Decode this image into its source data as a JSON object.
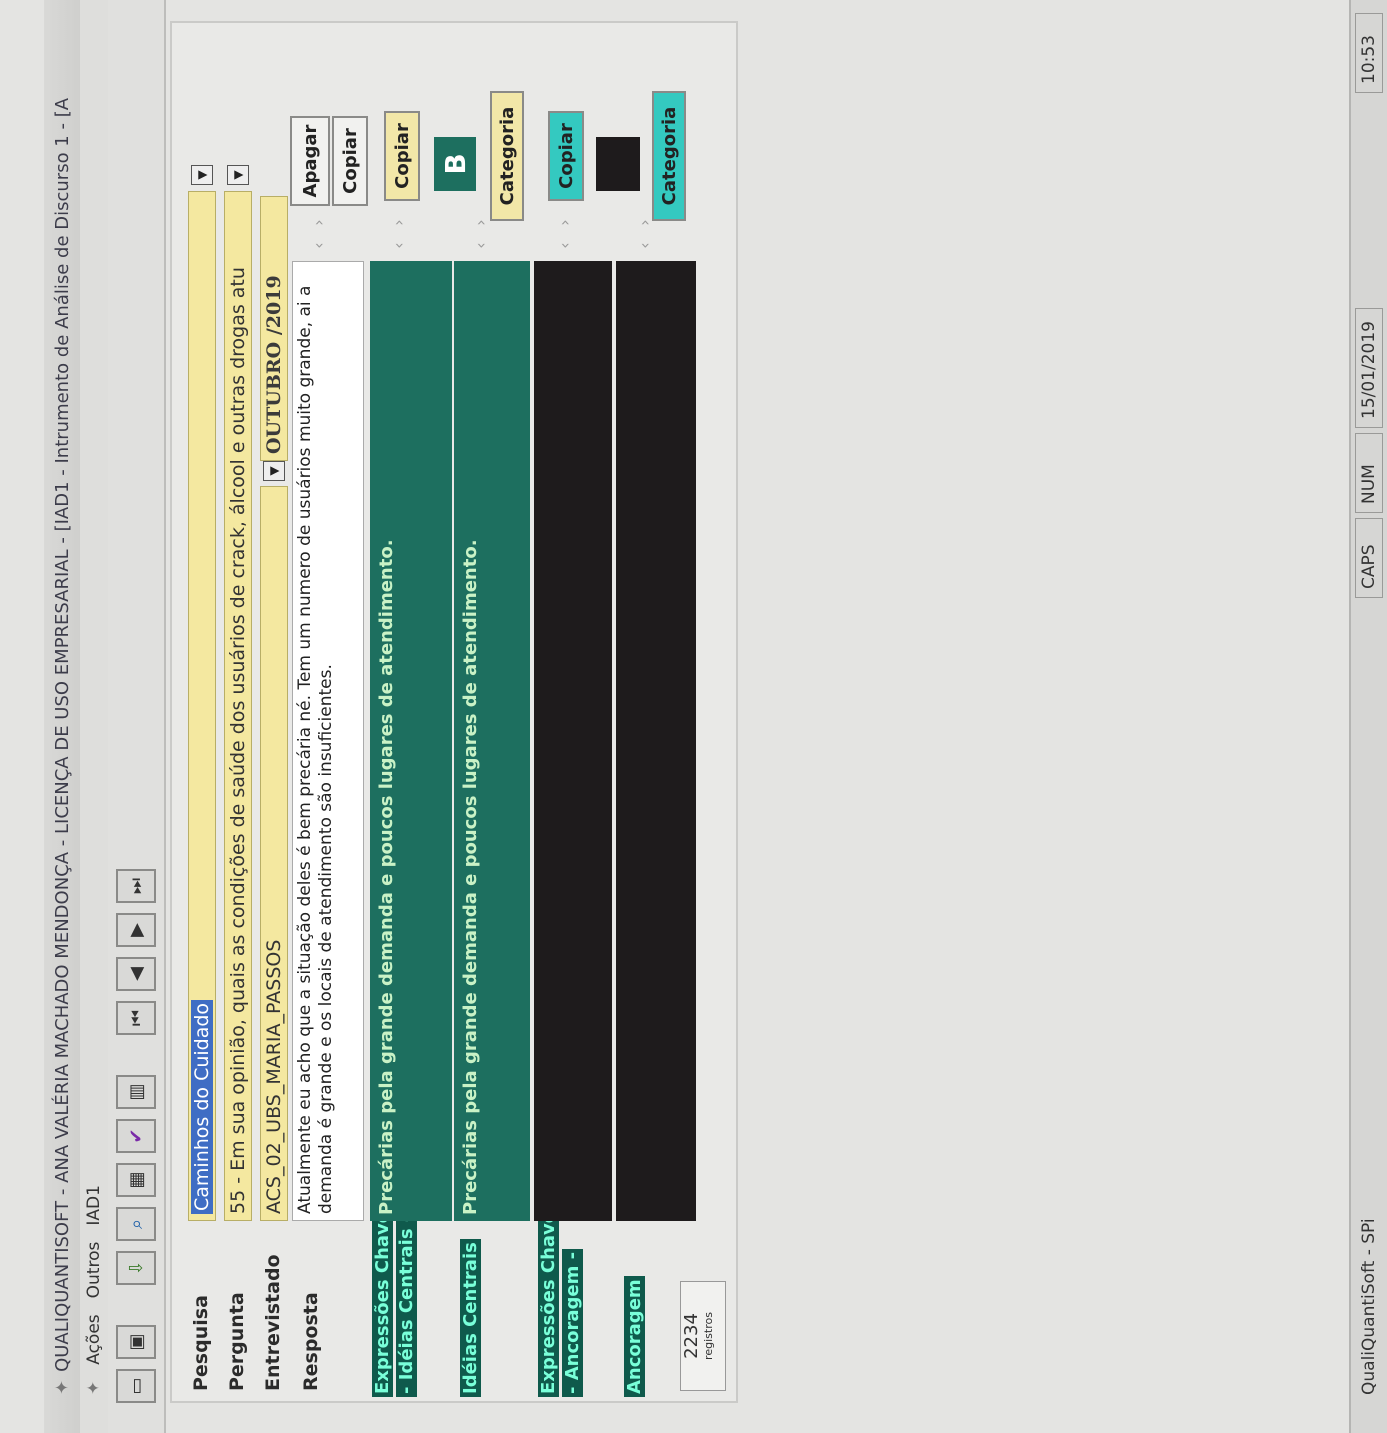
{
  "window": {
    "title": "QUALIQUANTISOFT - ANA VALÉRIA MACHADO MENDONÇA - LICENÇA DE USO EMPRESARIAL - [IAD1 - Intrumento de Análise de Discurso 1 - [A"
  },
  "menu": [
    "Ações",
    "Outros",
    "IAD1"
  ],
  "toolbar": {
    "icons": [
      "new-icon",
      "save-icon",
      "import-icon",
      "search-icon",
      "grid-icon",
      "spellcheck-icon",
      "delete-icon",
      "first-record-icon",
      "prev-record-icon",
      "next-record-icon",
      "last-record-icon"
    ]
  },
  "form": {
    "pesquisa_label": "Pesquisa",
    "pesquisa_value": "Caminhos do Cuidado",
    "pergunta_label": "Pergunta",
    "pergunta_value": "55 - Em sua opinião, quais as condições de saúde dos usuários de crack, álcool e outras drogas atu",
    "entrevistado_label": "Entrevistado",
    "entrevistado_value": "ACS_02_UBS_MARIA_PASSOS",
    "mes": "OUTUBRO /2019",
    "resposta_label": "Resposta",
    "resposta_text": "Atualmente eu acho que a situação deles é bem precária né. Tem um numero de usuários muito grande, ai a demanda é grande e os locais de atendimento são insuficientes.",
    "ec_label_1": "Expressões Chave",
    "ec_label_2": "- Idéias Centrais -",
    "ec_text": "Precárias pela grande demanda e poucos lugares de atendimento.",
    "ic_label": "Idéias Centrais",
    "ic_text": "Precárias pela grande demanda e poucos lugares de atendimento.",
    "eca_label_1": "Expressões Chave",
    "eca_label_2": "- Ancoragem -",
    "anc_label": "Ancoragem",
    "records_count": "2234",
    "records_label": "registros"
  },
  "buttons": {
    "apagar": "Apagar",
    "copiar": "Copiar",
    "copiar_ic": "Copiar",
    "category_letter": "B",
    "categoria": "Categoria",
    "copiar_anc": "Copiar",
    "categoria_anc": "Categoria"
  },
  "status": {
    "app": "QualiQuantiSoft - SPi",
    "caps": "CAPS",
    "num": "NUM",
    "date": "15/01/2019",
    "time": "10:53"
  },
  "colors": {
    "field_bg": "#f4e8a0",
    "green_box": "#1d6f5f",
    "label_highlight": "#79ffd9",
    "dark_box": "#1e1b1c",
    "copiar_cyan": "#34c9c0"
  }
}
